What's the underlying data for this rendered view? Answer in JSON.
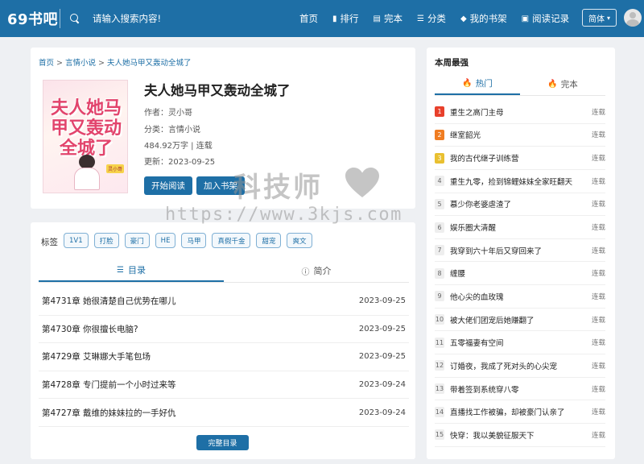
{
  "header": {
    "logo": "69书吧",
    "search_text": "请输入搜索内容!",
    "nav": [
      {
        "label": "首页",
        "icon": ""
      },
      {
        "label": "排行",
        "icon": "chart-icon"
      },
      {
        "label": "完本",
        "icon": "book-icon"
      },
      {
        "label": "分类",
        "icon": "list-icon"
      },
      {
        "label": "我的书架",
        "icon": "shelf-icon"
      },
      {
        "label": "阅读记录",
        "icon": "history-icon"
      }
    ],
    "lang": "简体"
  },
  "breadcrumb": {
    "home": "首页",
    "sep": ">",
    "category": "言情小说",
    "book": "夫人她马甲又轰动全城了"
  },
  "book": {
    "cover_title": "夫人她马甲又轰动全城了",
    "cover_tag": "灵小哥",
    "title": "夫人她马甲又轰动全城了",
    "author": "作者：灵小哥",
    "category": "分类：言情小说",
    "stats": "484.92万字 | 连载",
    "updated": "更新：2023-09-25",
    "read_btn": "开始阅读",
    "shelf_btn": "加入书架"
  },
  "tags": {
    "label": "标签",
    "items": [
      "1V1",
      "打脸",
      "豪门",
      "HE",
      "马甲",
      "真假千金",
      "甜宠",
      "爽文"
    ]
  },
  "tabs": {
    "catalog": "目录",
    "intro": "简介"
  },
  "chapters": [
    {
      "title": "第4731章 她很清楚自己优势在哪儿",
      "date": "2023-09-25"
    },
    {
      "title": "第4730章 你很擅长电脑?",
      "date": "2023-09-25"
    },
    {
      "title": "第4729章 艾琳娜大手笔包场",
      "date": "2023-09-25"
    },
    {
      "title": "第4728章 专门提前一个小时过来等",
      "date": "2023-09-24"
    },
    {
      "title": "第4727章 戴维的妹妹拉的一手好仇",
      "date": "2023-09-24"
    }
  ],
  "all_chapters_btn": "完整目录",
  "sidebar": {
    "title": "本周最强",
    "tab_hot": "热门",
    "tab_complete": "完本",
    "ranks": [
      {
        "num": "1",
        "title": "重生之高门主母",
        "status": "连载"
      },
      {
        "num": "2",
        "title": "继室韶光",
        "status": "连载"
      },
      {
        "num": "3",
        "title": "我的古代继子训练营",
        "status": "连载"
      },
      {
        "num": "4",
        "title": "重生九零，捡到锦鲤妹妹全家旺翻天",
        "status": "连载"
      },
      {
        "num": "5",
        "title": "慕少你老婆虐渣了",
        "status": "连载"
      },
      {
        "num": "6",
        "title": "娱乐圈大清醒",
        "status": "连载"
      },
      {
        "num": "7",
        "title": "我穿到六十年后又穿回来了",
        "status": "连载"
      },
      {
        "num": "8",
        "title": "缠腰",
        "status": "连载"
      },
      {
        "num": "9",
        "title": "他心尖的血玫瑰",
        "status": "连载"
      },
      {
        "num": "10",
        "title": "被大佬们团宠后她赚翻了",
        "status": "连载"
      },
      {
        "num": "11",
        "title": "五零福妻有空间",
        "status": "连载"
      },
      {
        "num": "12",
        "title": "订婚夜，我成了死对头的心尖宠",
        "status": "连载"
      },
      {
        "num": "13",
        "title": "带着签到系统穿八零",
        "status": "连载"
      },
      {
        "num": "14",
        "title": "直播找工作被骗，却被豪门认亲了",
        "status": "连载"
      },
      {
        "num": "15",
        "title": "快穿：我以美貌征服天下",
        "status": "连载"
      }
    ]
  },
  "watermark": {
    "line1": "科技师",
    "line2": "https://www.3kjs.com"
  }
}
